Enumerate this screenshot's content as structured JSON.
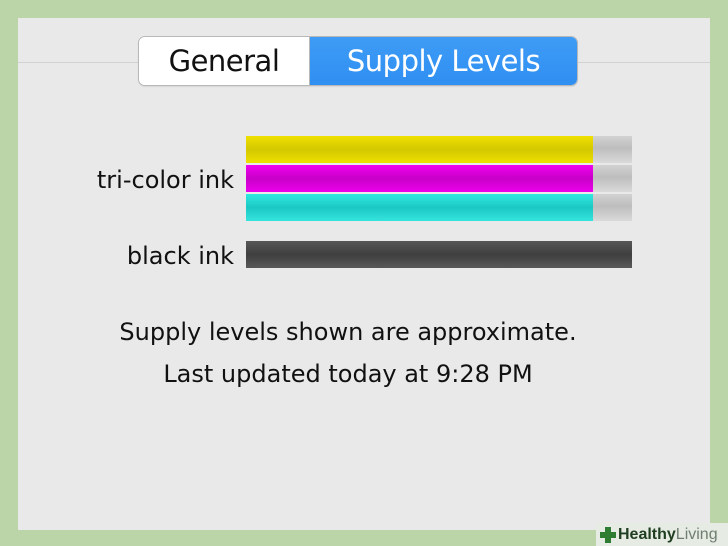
{
  "tabs": [
    {
      "label": "General",
      "selected": false
    },
    {
      "label": "Supply Levels",
      "selected": true
    }
  ],
  "supplies": {
    "tricolor": {
      "label": "tri-color ink",
      "channels": [
        {
          "name": "yellow",
          "color": "#e6d800",
          "level": 0.9
        },
        {
          "name": "magenta",
          "color": "#e000e0",
          "level": 0.9
        },
        {
          "name": "cyan",
          "color": "#26d8d2",
          "level": 0.9
        }
      ]
    },
    "black": {
      "label": "black ink",
      "color": "#4a4a4a",
      "level": 1.0
    }
  },
  "footer": {
    "line1": "Supply levels shown are approximate.",
    "line2": "Last updated today at 9:28 PM"
  },
  "watermark": {
    "part1": "Healthy",
    "part2": "Living"
  }
}
